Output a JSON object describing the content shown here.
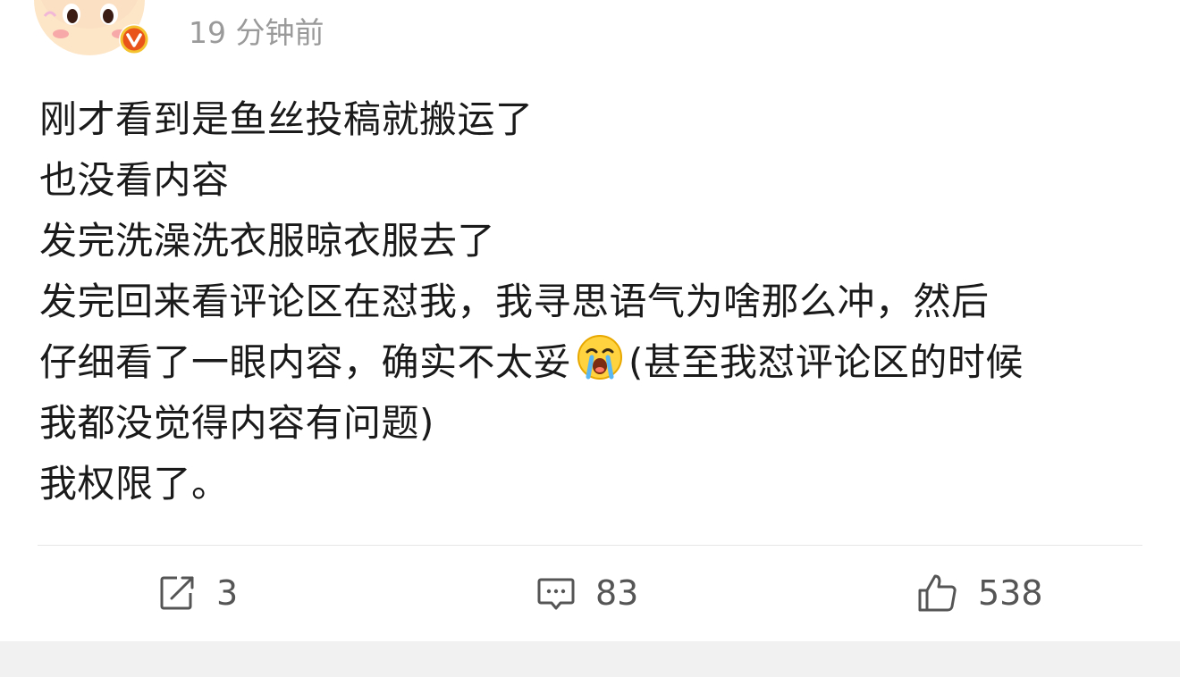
{
  "post": {
    "timestamp": "19 分钟前",
    "lines": [
      "刚才看到是鱼丝投稿就搬运了",
      "也没看内容",
      "发完洗澡洗衣服晾衣服去了",
      "发完回来看评论区在怼我，我寻思语气为啥那么冲，然后",
      "仔细看了一眼内容，确实不太妥",
      "(甚至我怼评论区的时候",
      "我都没觉得内容有问题)",
      "我权限了。"
    ],
    "emoji": "crying-face-emoji",
    "verified_badge_color": "#e8541a",
    "avatar_bg": "#fde6c8"
  },
  "actions": {
    "repost_count": "3",
    "comment_count": "83",
    "like_count": "538"
  }
}
